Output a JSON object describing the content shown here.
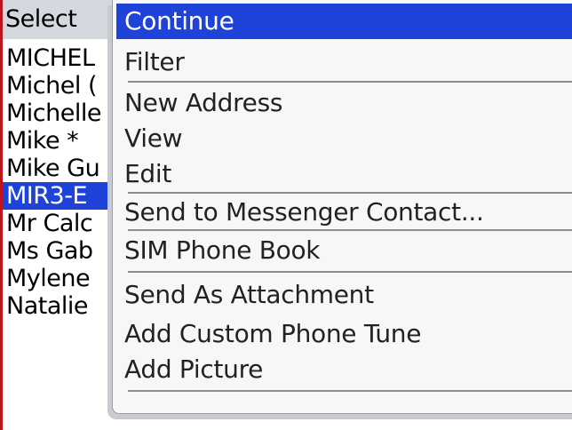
{
  "list": {
    "header": "Select",
    "contacts": [
      "MICHEL",
      "Michel (",
      "Michelle",
      "Mike *",
      "Mike Gu",
      "MIR3-E",
      "Mr Calc",
      "Ms Gab",
      "Mylene",
      "Natalie"
    ],
    "selected_index": 5
  },
  "menu": {
    "items": [
      "Continue",
      "Filter",
      "New Address",
      "View",
      "Edit",
      "Send to Messenger Contact...",
      "SIM Phone Book",
      "Send As Attachment",
      "Add Custom Phone Tune",
      "Add Picture"
    ],
    "highlighted_index": 0
  },
  "colors": {
    "highlight": "#1f43d8",
    "frame": "#c0141c",
    "header_bg": "#d4d8df"
  }
}
